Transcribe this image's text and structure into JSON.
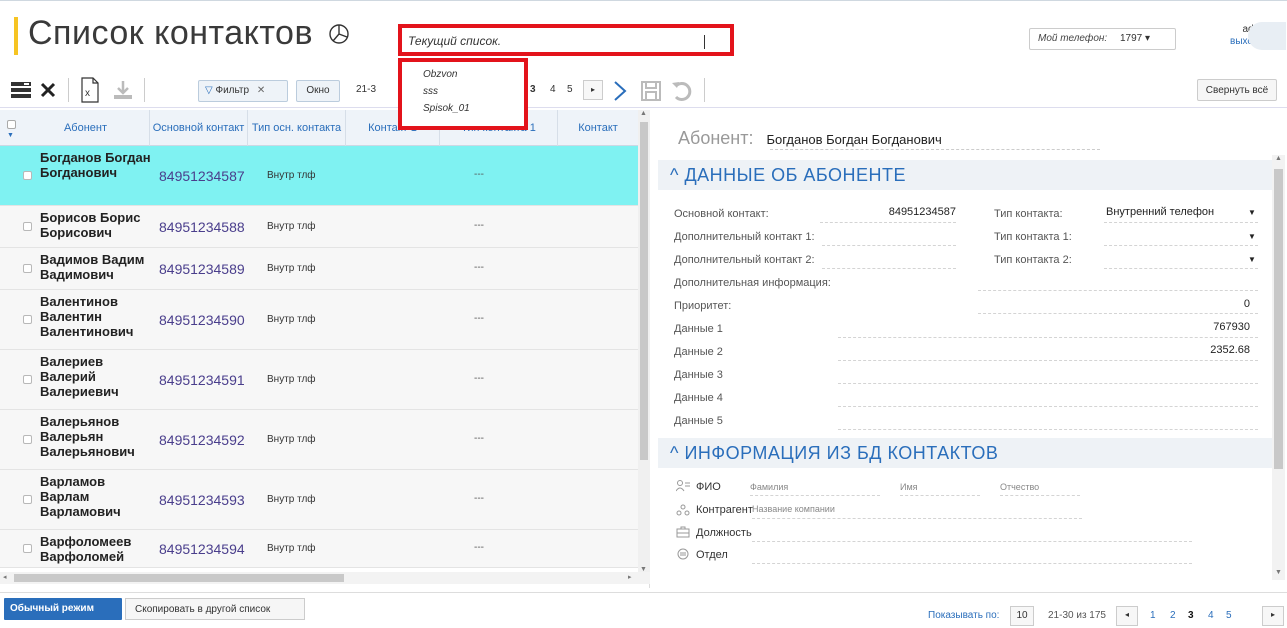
{
  "header": {
    "title": "Список контактов",
    "current_list_placeholder": "Текущий список.",
    "list_options": [
      "Obzvon",
      "sss",
      "Spisok_01"
    ],
    "phone_label": "Мой телефон:",
    "phone_value": "1797 ▾",
    "user": "admin",
    "logout": "выход"
  },
  "toolbar": {
    "filter_label": "Фильтр",
    "filter_close": "✕",
    "window_label": "Окно",
    "range_prefix": "21-3",
    "pages": [
      "3",
      "4",
      "5"
    ],
    "collapse_label": "Свернуть всё"
  },
  "table": {
    "columns": [
      "Абонент",
      "Основной контакт",
      "Тип осн. контакта",
      "Контакт 1",
      "Тип контакта 1",
      "Контакт"
    ],
    "rows": [
      {
        "name": "Богданов Богдан Богданович",
        "contact": "84951234587",
        "type": "Внутр тлф",
        "dash": "---",
        "selected": true
      },
      {
        "name": "Борисов Борис Борисович",
        "contact": "84951234588",
        "type": "Внутр тлф",
        "dash": "---",
        "selected": false
      },
      {
        "name": "Вадимов Вадим Вадимович",
        "contact": "84951234589",
        "type": "Внутр тлф",
        "dash": "---",
        "selected": false
      },
      {
        "name": "Валентинов Валентин Валентинович",
        "contact": "84951234590",
        "type": "Внутр тлф",
        "dash": "---",
        "selected": false
      },
      {
        "name": "Валериев Валерий Валериевич",
        "contact": "84951234591",
        "type": "Внутр тлф",
        "dash": "---",
        "selected": false
      },
      {
        "name": "Валерьянов Валерьян Валерьянович",
        "contact": "84951234592",
        "type": "Внутр тлф",
        "dash": "---",
        "selected": false
      },
      {
        "name": "Варламов Варлам Варламович",
        "contact": "84951234593",
        "type": "Внутр тлф",
        "dash": "---",
        "selected": false
      },
      {
        "name": "Варфоломеев Варфоломей",
        "contact": "84951234594",
        "type": "Внутр тлф",
        "dash": "---",
        "selected": false
      }
    ]
  },
  "detail": {
    "abonent_label": "Абонент:",
    "abonent_name": "Богданов Богдан Богданович",
    "section1": "ДАННЫЕ ОБ АБОНЕНТЕ",
    "main_contact_label": "Основной контакт:",
    "main_contact_value": "84951234587",
    "contact_type_label": "Тип контакта:",
    "contact_type_value": "Внутренний телефон",
    "extra1_label": "Дополнительный контакт 1:",
    "type1_label": "Тип контакта 1:",
    "extra2_label": "Дополнительный контакт 2:",
    "type2_label": "Тип контакта 2:",
    "extra_info_label": "Дополнительная информация:",
    "priority_label": "Приоритет:",
    "priority_value": "0",
    "data1_label": "Данные 1",
    "data1_value": "767930",
    "data2_label": "Данные 2",
    "data2_value": "2352.68",
    "data3_label": "Данные 3",
    "data4_label": "Данные 4",
    "data5_label": "Данные 5",
    "section2": "ИНФОРМАЦИЯ ИЗ БД КОНТАКТОВ",
    "fio_label": "ФИО",
    "surname_ph": "Фамилия",
    "name_ph": "Имя",
    "patronymic_ph": "Отчество",
    "counterparty_label": "Контрагент",
    "company_ph": "Название компании",
    "position_label": "Должность",
    "department_label": "Отдел"
  },
  "footer": {
    "mode": "Обычный режим",
    "copy": "Скопировать в другой список",
    "show_by": "Показывать по:",
    "page_size": "10",
    "range": "21-30 из 175",
    "pages": [
      "1",
      "2",
      "3",
      "4",
      "5"
    ],
    "current_page": "3"
  },
  "colors": {
    "accent": "#2a6ebb",
    "selected_row": "#7ff2f2",
    "highlight": "#e3131b",
    "title_bar": "#f6c423"
  }
}
